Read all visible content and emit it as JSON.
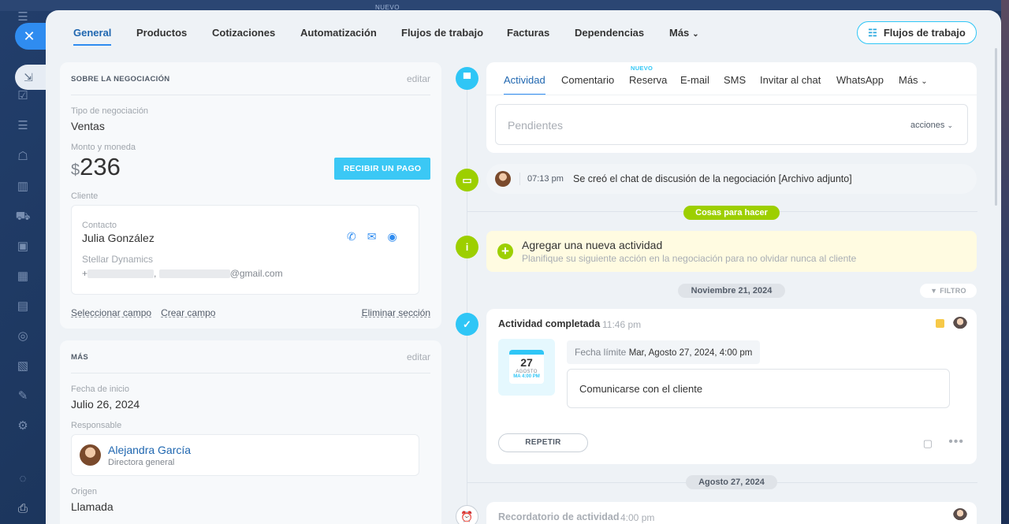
{
  "top_badge": "NUEVO",
  "rail": {
    "icons": [
      "menu-icon",
      "user-icon",
      "tasks-icon",
      "filter-icon",
      "robot-icon",
      "chart-icon",
      "cart-icon",
      "mail-icon",
      "calendar-icon",
      "database-icon",
      "target-icon",
      "doc-icon",
      "pen-icon",
      "settings-icon",
      "globe-icon",
      "print-icon"
    ]
  },
  "tabs": [
    {
      "label": "General"
    },
    {
      "label": "Productos"
    },
    {
      "label": "Cotizaciones"
    },
    {
      "label": "Automatización"
    },
    {
      "label": "Flujos de trabajo"
    },
    {
      "label": "Facturas"
    },
    {
      "label": "Dependencias"
    },
    {
      "label": "Más"
    }
  ],
  "flow_button": "Flujos de trabajo",
  "deal": {
    "header": "SOBRE LA NEGOCIACIÓN",
    "edit": "editar",
    "type_label": "Tipo de negociación",
    "type_value": "Ventas",
    "amount_label": "Monto y moneda",
    "currency": "$",
    "amount": "236",
    "pay_button": "RECIBIR UN PAGO",
    "client_label": "Cliente",
    "contact_label": "Contacto",
    "contact_name": "Julia González",
    "company": "Stellar Dynamics",
    "phone_prefix": "+",
    "comma": ",",
    "email_suffix": "@gmail.com",
    "select_field": "Seleccionar campo",
    "create_field": "Crear campo",
    "delete_section": "Eliminar sección"
  },
  "more": {
    "header": "MÁS",
    "edit": "editar",
    "start_label": "Fecha de inicio",
    "start_value": "Julio 26, 2024",
    "resp_label": "Responsable",
    "resp_name": "Alejandra García",
    "resp_title": "Directora general",
    "origin_label": "Origen",
    "origin_value": "Llamada"
  },
  "editor": {
    "tabs": [
      "Actividad",
      "Comentario",
      "Reserva",
      "E-mail",
      "SMS",
      "Invitar al chat",
      "WhatsApp",
      "Más"
    ],
    "new_badge": "NUEVO",
    "placeholder": "Pendientes",
    "actions": "acciones"
  },
  "chat": {
    "time": "07:13 pm",
    "text": "Se creó el chat de discusión de la negociación [Archivo adjunto]"
  },
  "todo_pill": "Cosas para hacer",
  "todo": {
    "title": "Agregar una nueva actividad",
    "subtitle": "Planifique su siguiente acción en la negociación para no olvidar nunca al cliente"
  },
  "date1": "Noviembre 21, 2024",
  "filter": "FILTRO",
  "activity": {
    "title": "Actividad completada",
    "time": "11:46 pm",
    "cal_day": "27",
    "cal_month": "AGOSTO",
    "cal_time": "MA 4:00 PM",
    "deadline_label": "Fecha límite",
    "deadline_value": "Mar, Agosto 27, 2024, 4:00 pm",
    "task": "Comunicarse con el cliente",
    "repeat": "REPETIR"
  },
  "date2": "Agosto 27, 2024",
  "reminder": {
    "title": "Recordatorio de actividad",
    "time": "4:00 pm"
  },
  "colors": {
    "accent": "#2f8cf0",
    "cyan": "#2fc6f6",
    "green": "#9dcf00"
  }
}
